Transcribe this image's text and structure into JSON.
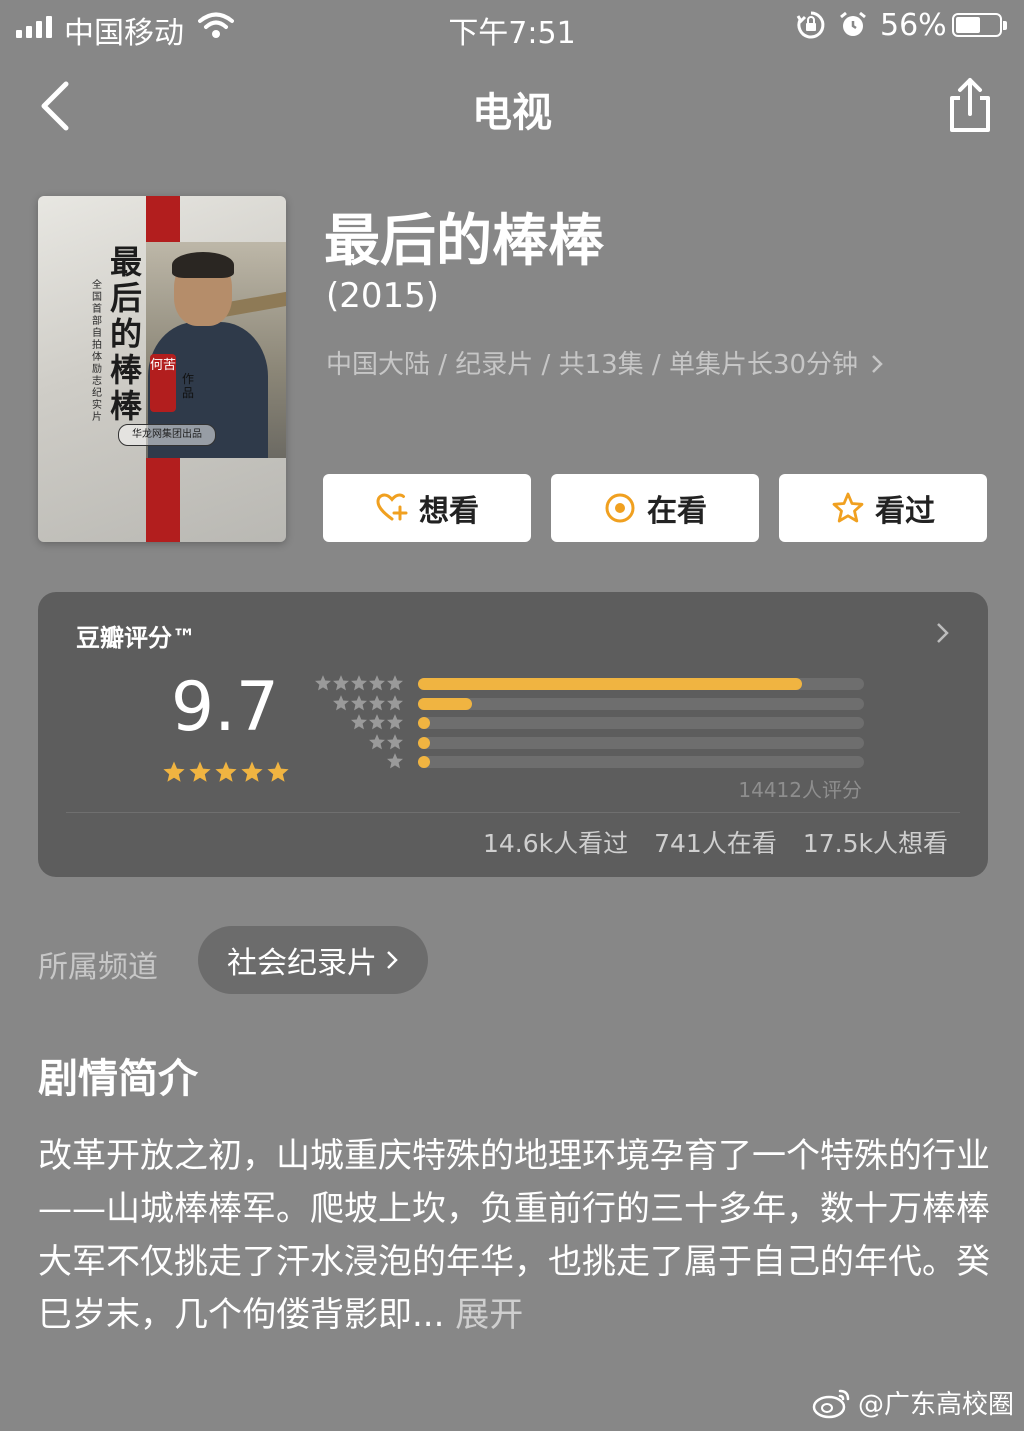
{
  "status_bar": {
    "carrier": "中国移动",
    "time": "下午7:51",
    "battery": "56%",
    "battery_level": 0.56
  },
  "nav": {
    "title": "电视"
  },
  "poster": {
    "title_text": "最后的棒棒",
    "subtitle_text": "全国首部自拍体励志纪实片",
    "stamp_text": "何苦",
    "works_text": "作品",
    "publisher_text": "华龙网集团出品"
  },
  "show": {
    "title": "最后的棒棒",
    "year": "(2015)",
    "meta": "中国大陆 / 纪录片 / 共13集 / 单集片长30分钟"
  },
  "actions": {
    "want": "想看",
    "watching": "在看",
    "watched": "看过"
  },
  "rating": {
    "label": "豆瓣评分™",
    "score": "9.7",
    "stars": 5,
    "count": "14412人评分",
    "distribution": [
      0.86,
      0.12,
      0.02,
      0.02,
      0.02
    ],
    "watched": "14.6k人看过",
    "watching": "741人在看",
    "want": "17.5k人想看",
    "accent": "#f0b441"
  },
  "channel": {
    "label": "所属频道",
    "value": "社会纪录片"
  },
  "synopsis": {
    "title": "剧情简介",
    "text": "改革开放之初，山城重庆特殊的地理环境孕育了一个特殊的行业——山城棒棒军。爬坡上坎，负重前行的三十多年，数十万棒棒大军不仅挑走了汗水浸泡的年华，也挑走了属于自己的年代。癸巳岁末，几个佝偻背影即...",
    "more": "展开"
  },
  "watermark": {
    "text": "@广东高校圈"
  }
}
